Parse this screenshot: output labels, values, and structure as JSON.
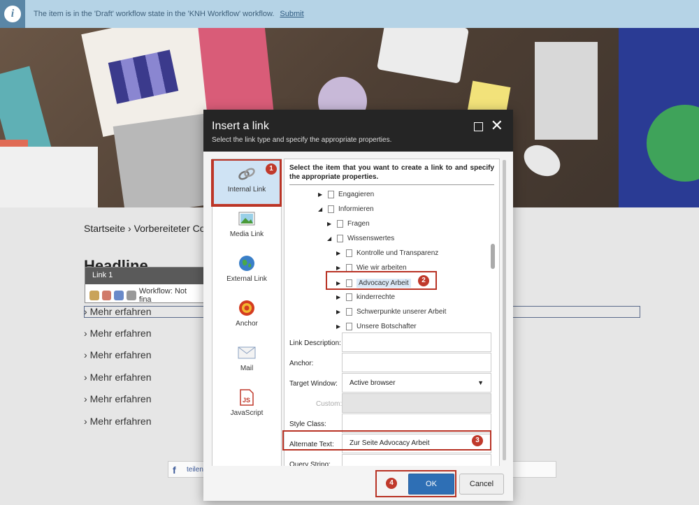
{
  "notification": {
    "message": "The item is in the 'Draft' workflow state in the 'KNH Workflow' workflow.",
    "action": "Submit",
    "icon": "info-icon"
  },
  "page": {
    "breadcrumb": "Startseite › Vorbereiteter Co",
    "headline": "Headline",
    "toolbar": {
      "title": "Link 1",
      "workflow": "Workflow: Not fina"
    },
    "links": [
      "Mehr erfahren",
      "Mehr erfahren",
      "Mehr erfahren",
      "Mehr erfahren",
      "Mehr erfahren",
      "Mehr erfahren"
    ],
    "share": {
      "icon": "f",
      "label": "teilen"
    }
  },
  "dialog": {
    "title": "Insert a link",
    "subtitle": "Select the link type and specify the appropriate properties.",
    "link_types": [
      {
        "label": "Internal Link",
        "icon": "chain-link-icon",
        "active": true
      },
      {
        "label": "Media Link",
        "icon": "picture-icon",
        "active": false
      },
      {
        "label": "External Link",
        "icon": "globe-icon",
        "active": false
      },
      {
        "label": "Anchor",
        "icon": "target-icon",
        "active": false
      },
      {
        "label": "Mail",
        "icon": "envelope-icon",
        "active": false
      },
      {
        "label": "JavaScript",
        "icon": "js-file-icon",
        "active": false
      }
    ],
    "instruction": "Select the item that you want to create a link to and specify the appropriate properties.",
    "tree": [
      {
        "label": "Engagieren",
        "level": 1,
        "expanded": false,
        "selected": false
      },
      {
        "label": "Informieren",
        "level": 1,
        "expanded": true,
        "selected": false
      },
      {
        "label": "Fragen",
        "level": 2,
        "expanded": false,
        "selected": false
      },
      {
        "label": "Wissenswertes",
        "level": 2,
        "expanded": true,
        "selected": false
      },
      {
        "label": "Kontrolle und Transparenz",
        "level": 3,
        "expanded": false,
        "selected": false
      },
      {
        "label": "Wie wir arbeiten",
        "level": 3,
        "expanded": false,
        "selected": false
      },
      {
        "label": "Advocacy Arbeit",
        "level": 3,
        "expanded": false,
        "selected": true
      },
      {
        "label": "kinderrechte",
        "level": 3,
        "expanded": false,
        "selected": false
      },
      {
        "label": "Schwerpunkte unserer Arbeit",
        "level": 3,
        "expanded": false,
        "selected": false
      },
      {
        "label": "Unsere Botschafter",
        "level": 3,
        "expanded": false,
        "selected": false
      }
    ],
    "fields": {
      "link_description": {
        "label": "Link Description:",
        "value": ""
      },
      "anchor": {
        "label": "Anchor:",
        "value": ""
      },
      "target_window": {
        "label": "Target Window:",
        "value": "Active browser"
      },
      "custom": {
        "label": "Custom:",
        "value": ""
      },
      "style_class": {
        "label": "Style Class:",
        "value": ""
      },
      "alternate_text": {
        "label": "Alternate Text:",
        "value": "Zur Seite Advocacy Arbeit"
      },
      "query_string": {
        "label": "Query String:",
        "value": ""
      }
    },
    "ok_label": "OK",
    "cancel_label": "Cancel"
  },
  "callouts": [
    "1",
    "2",
    "3",
    "4"
  ],
  "colors": {
    "accent": "#2e6fb5",
    "callout": "#c0392b",
    "notification": "#b5d3e6"
  }
}
